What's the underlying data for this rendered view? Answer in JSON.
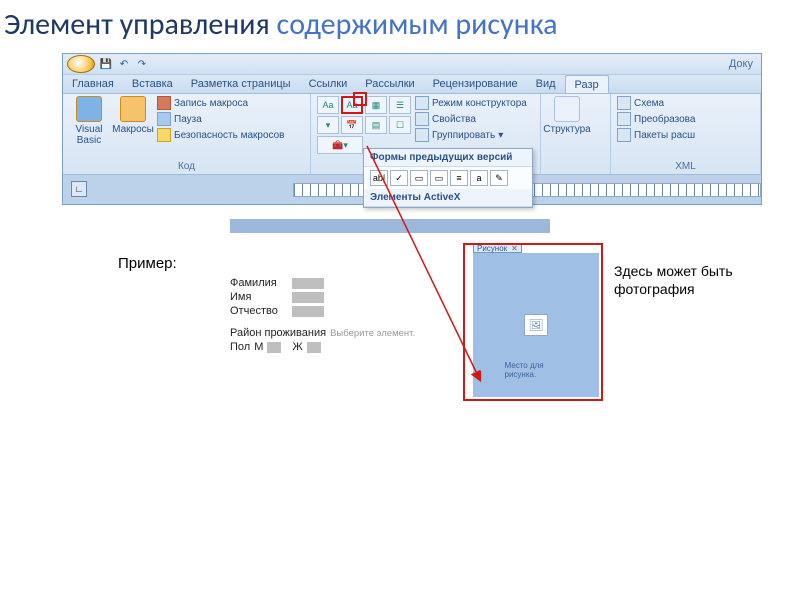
{
  "title": {
    "line1": "Элемент управления ",
    "accent": "содержимым рисунка"
  },
  "titlebar": {
    "doc": "Доку"
  },
  "tabs": [
    "Главная",
    "Вставка",
    "Разметка страницы",
    "Ссылки",
    "Рассылки",
    "Рецензирование",
    "Вид",
    "Разр"
  ],
  "active_tab": 7,
  "groups": {
    "code": {
      "vb": "Visual Basic",
      "macros": "Макросы",
      "rec": "Запись макроса",
      "pause": "Пауза",
      "sec": "Безопасность макросов",
      "label": "Код"
    },
    "controls": {
      "aa1": "Aa",
      "aa2": "Aa",
      "design": "Режим конструктора",
      "props": "Свойства",
      "group": "Группировать"
    },
    "struct": {
      "btn": "Структура",
      "schema": "Схема",
      "transform": "Преобразова",
      "packs": "Пакеты расш",
      "label": "XML"
    }
  },
  "popup": {
    "hdr1": "Формы предыдущих версий",
    "icons": [
      "ab|",
      "✓",
      "▭",
      "▭",
      "≡",
      "a",
      "✎"
    ],
    "hdr2": "Элементы ActiveX"
  },
  "example": {
    "label": "Пример:",
    "fields": {
      "lastname": "Фамилия",
      "firstname": "Имя",
      "patronym": "Отчество",
      "region": "Район проживания",
      "region_hint": "Выберите элемент.",
      "sex": "Пол",
      "m": "М",
      "f": "Ж"
    },
    "pic_tab": "Рисунок",
    "pic_hint": "Место для рисунка.",
    "caption": "Здесь может быть фотография"
  }
}
